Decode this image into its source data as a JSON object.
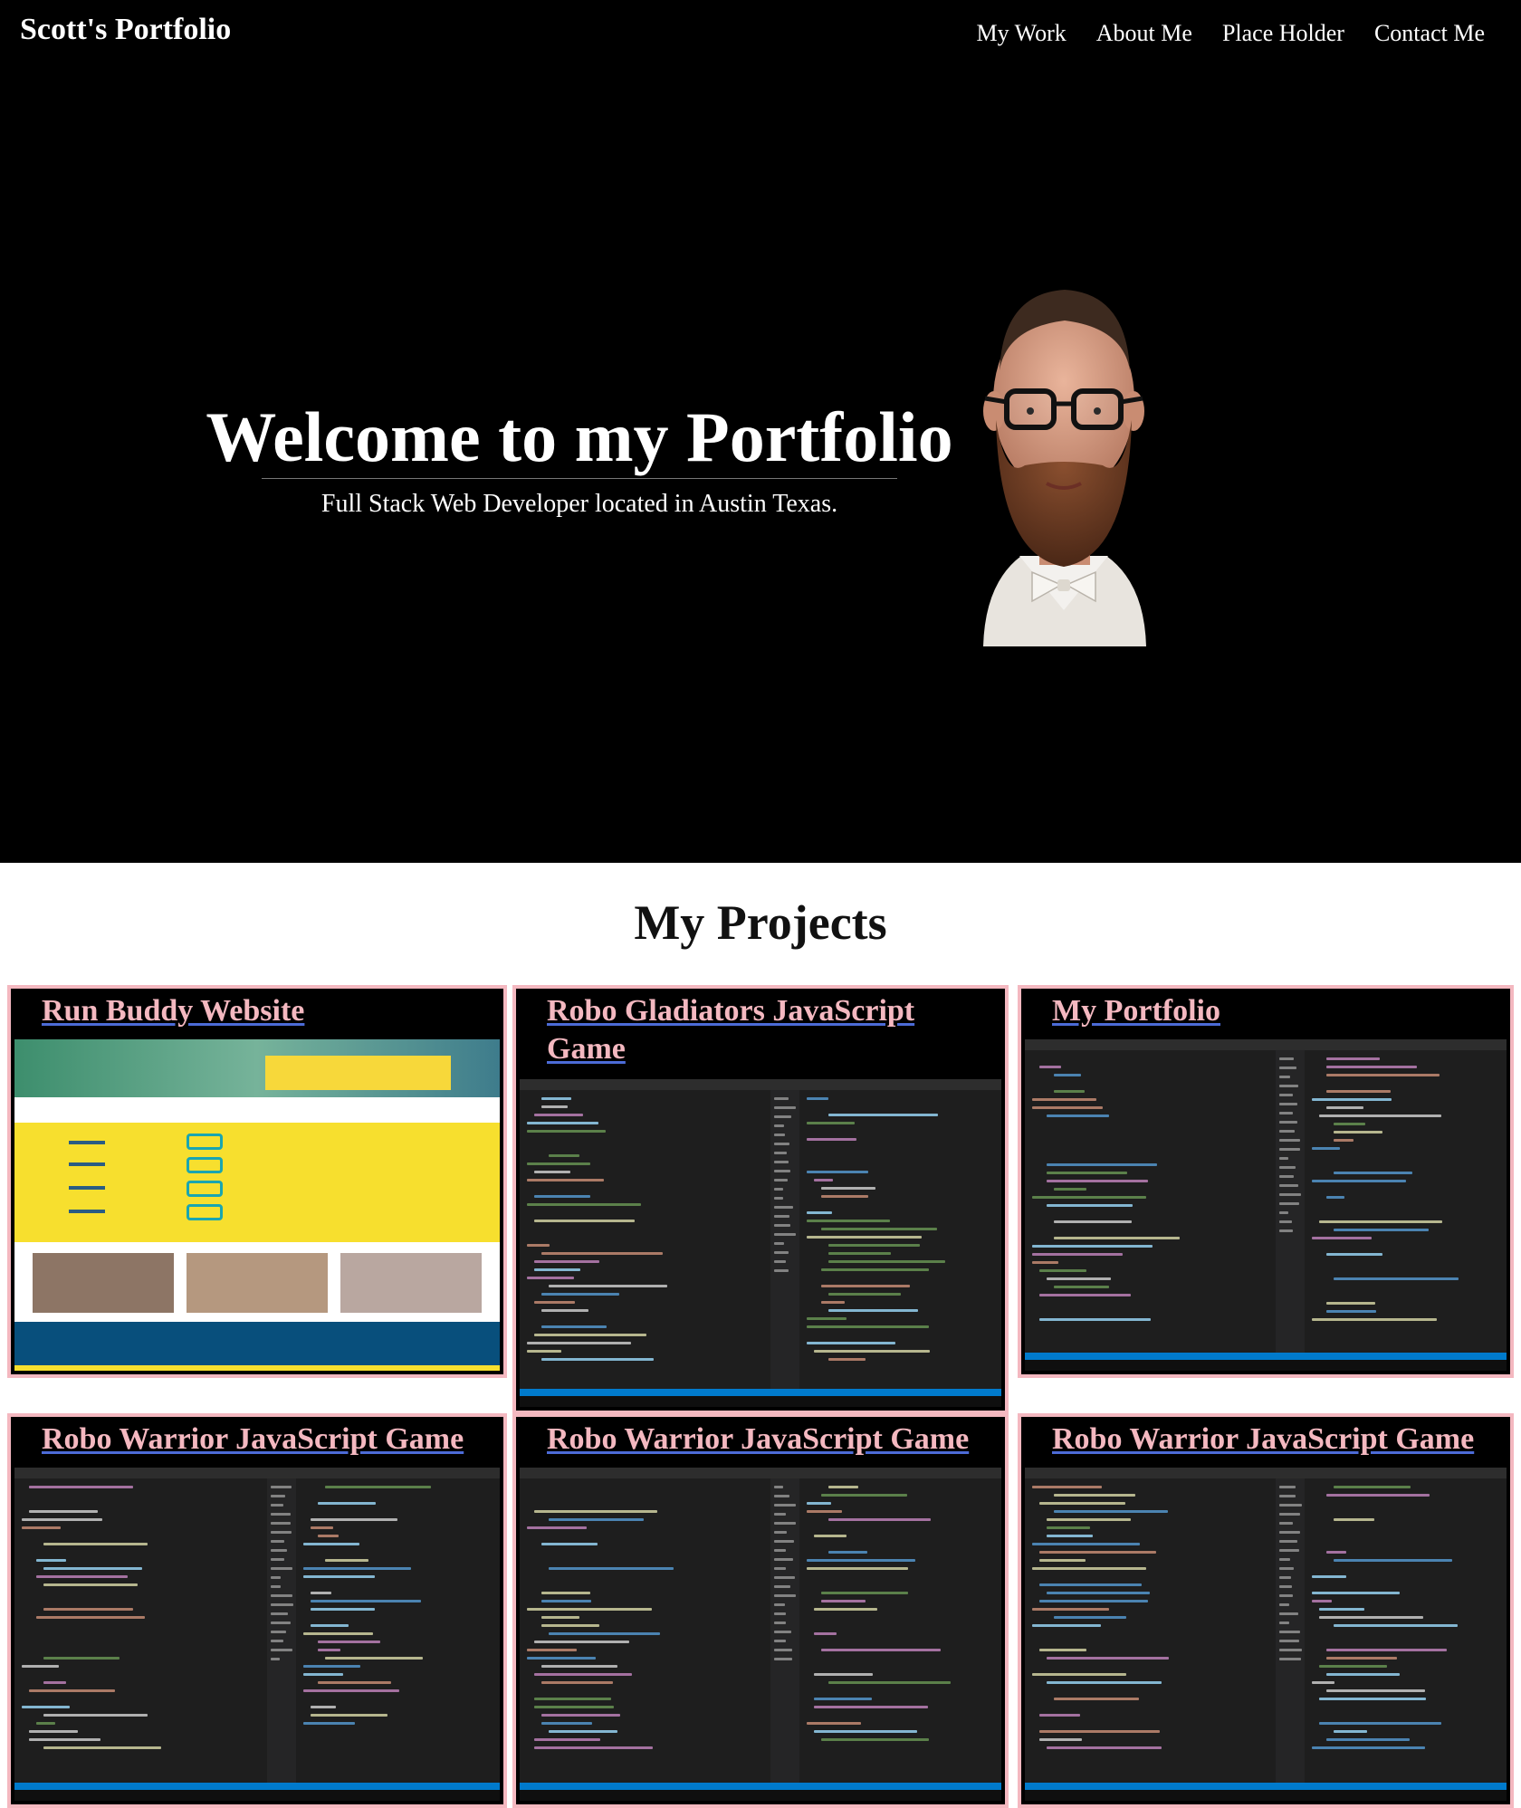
{
  "header": {
    "brand": "Scott's Portfolio",
    "nav": [
      "My Work",
      "About Me",
      "Place Holder",
      "Contact Me"
    ]
  },
  "hero": {
    "title": "Welcome to my Portfolio",
    "subtitle": "Full Stack Web Developer located in Austin Texas.",
    "portrait_icon": "portrait-photo"
  },
  "projects": {
    "heading": "My Projects",
    "cards": [
      {
        "title": "Run Buddy Website",
        "preview": "run-buddy-screenshot"
      },
      {
        "title": "Robo Gladiators JavaScript Game",
        "preview": "code-editor-screenshot"
      },
      {
        "title": "My Portfolio",
        "preview": "code-editor-screenshot"
      },
      {
        "title": "Robo Warrior JavaScript Game",
        "preview": "code-editor-screenshot"
      },
      {
        "title": "Robo Warrior JavaScript Game",
        "preview": "code-editor-screenshot"
      },
      {
        "title": "Robo Warrior JavaScript Game",
        "preview": "code-editor-screenshot"
      }
    ]
  },
  "colors": {
    "hero_bg": "#000000",
    "card_border": "#f4b8c0",
    "card_title": "#f4b8c0",
    "link_underline": "#4c6bd7"
  }
}
